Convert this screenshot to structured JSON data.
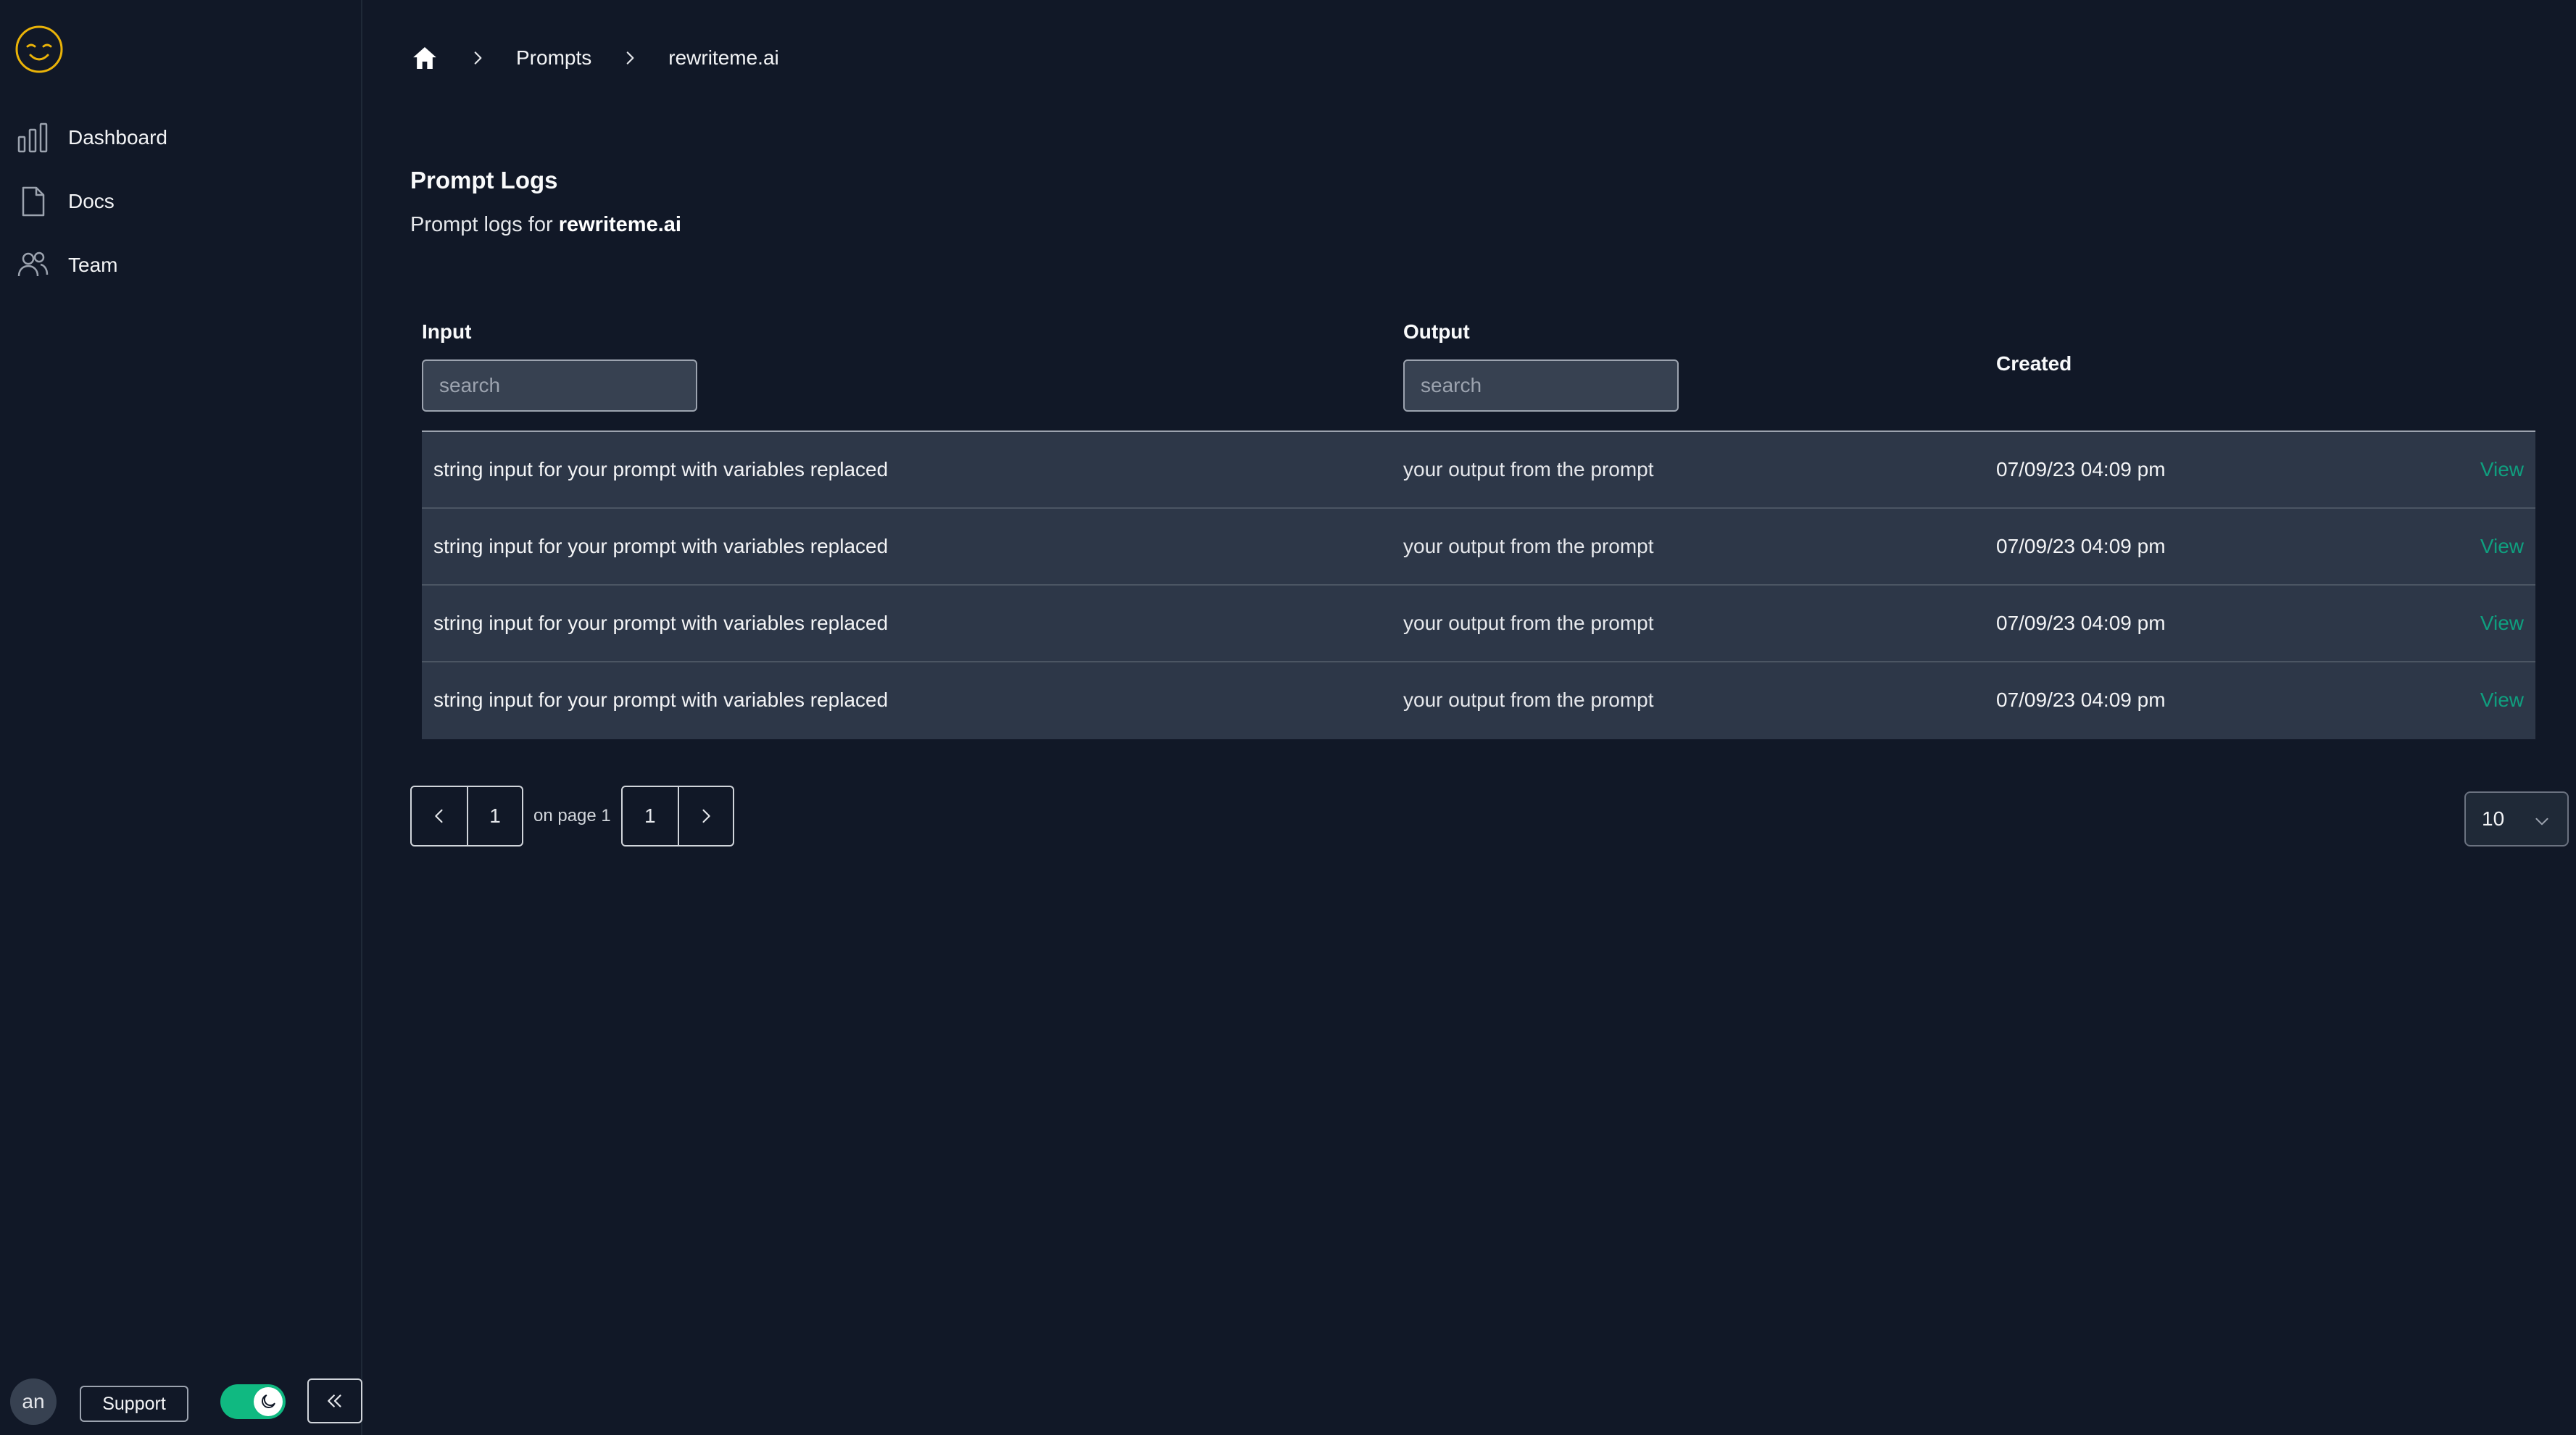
{
  "colors": {
    "background": "#111827",
    "row_background": "#2d3748",
    "accent_green": "#10b981",
    "link_green": "#0f9f7f",
    "logo_yellow": "#eab308"
  },
  "sidebar": {
    "logo_icon": "smiley-face-icon",
    "items": [
      {
        "label": "Dashboard",
        "icon": "bar-chart-icon"
      },
      {
        "label": "Docs",
        "icon": "document-icon"
      },
      {
        "label": "Team",
        "icon": "users-icon"
      }
    ],
    "footer": {
      "avatar_initials": "an",
      "support_label": "Support",
      "theme_toggle_on": true,
      "theme_icon": "moon-icon",
      "collapse_icon": "double-chevron-left-icon"
    }
  },
  "breadcrumb": {
    "home_icon": "home-icon",
    "items": [
      "Prompts",
      "rewriteme.ai"
    ]
  },
  "page": {
    "title": "Prompt Logs",
    "subtitle_prefix": "Prompt logs for ",
    "subtitle_project": "rewriteme.ai"
  },
  "table": {
    "columns": {
      "input": {
        "label": "Input",
        "search_placeholder": "search"
      },
      "output": {
        "label": "Output",
        "search_placeholder": "search"
      },
      "created": {
        "label": "Created"
      }
    },
    "rows": [
      {
        "input": "string input for your prompt with variables replaced",
        "output": "your output from the prompt",
        "created": "07/09/23 04:09 pm",
        "action": "View"
      },
      {
        "input": "string input for your prompt with variables replaced",
        "output": "your output from the prompt",
        "created": "07/09/23 04:09 pm",
        "action": "View"
      },
      {
        "input": "string input for your prompt with variables replaced",
        "output": "your output from the prompt",
        "created": "07/09/23 04:09 pm",
        "action": "View"
      },
      {
        "input": "string input for your prompt with variables replaced",
        "output": "your output from the prompt",
        "created": "07/09/23 04:09 pm",
        "action": "View"
      }
    ]
  },
  "pagination": {
    "current_page": "1",
    "on_page_text": "on page 1",
    "total_pages": "1",
    "page_size": "10"
  }
}
